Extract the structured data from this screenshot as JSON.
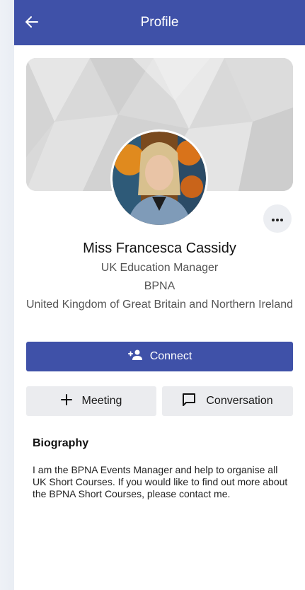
{
  "header": {
    "title": "Profile",
    "back_icon": "arrow-left-icon"
  },
  "profile": {
    "name": "Miss Francesca Cassidy",
    "job_title": "UK Education Manager",
    "organisation": "BPNA",
    "country": "United Kingdom of Great Britain and Northern Ireland",
    "more_icon": "more-horizontal-icon"
  },
  "actions": {
    "connect_label": "Connect",
    "connect_icon": "add-person-icon",
    "meeting_label": "Meeting",
    "meeting_icon": "plus-icon",
    "conversation_label": "Conversation",
    "conversation_icon": "chat-bubble-icon"
  },
  "biography": {
    "heading": "Biography",
    "text": "I am the BPNA Events Manager and help to organise all UK Short Courses. If you would like to find out more about the BPNA Short Courses, please contact me."
  },
  "colors": {
    "primary": "#3F51A8",
    "secondary_button": "#EBECEF",
    "text_dark": "#111111",
    "text_muted": "#555555"
  }
}
